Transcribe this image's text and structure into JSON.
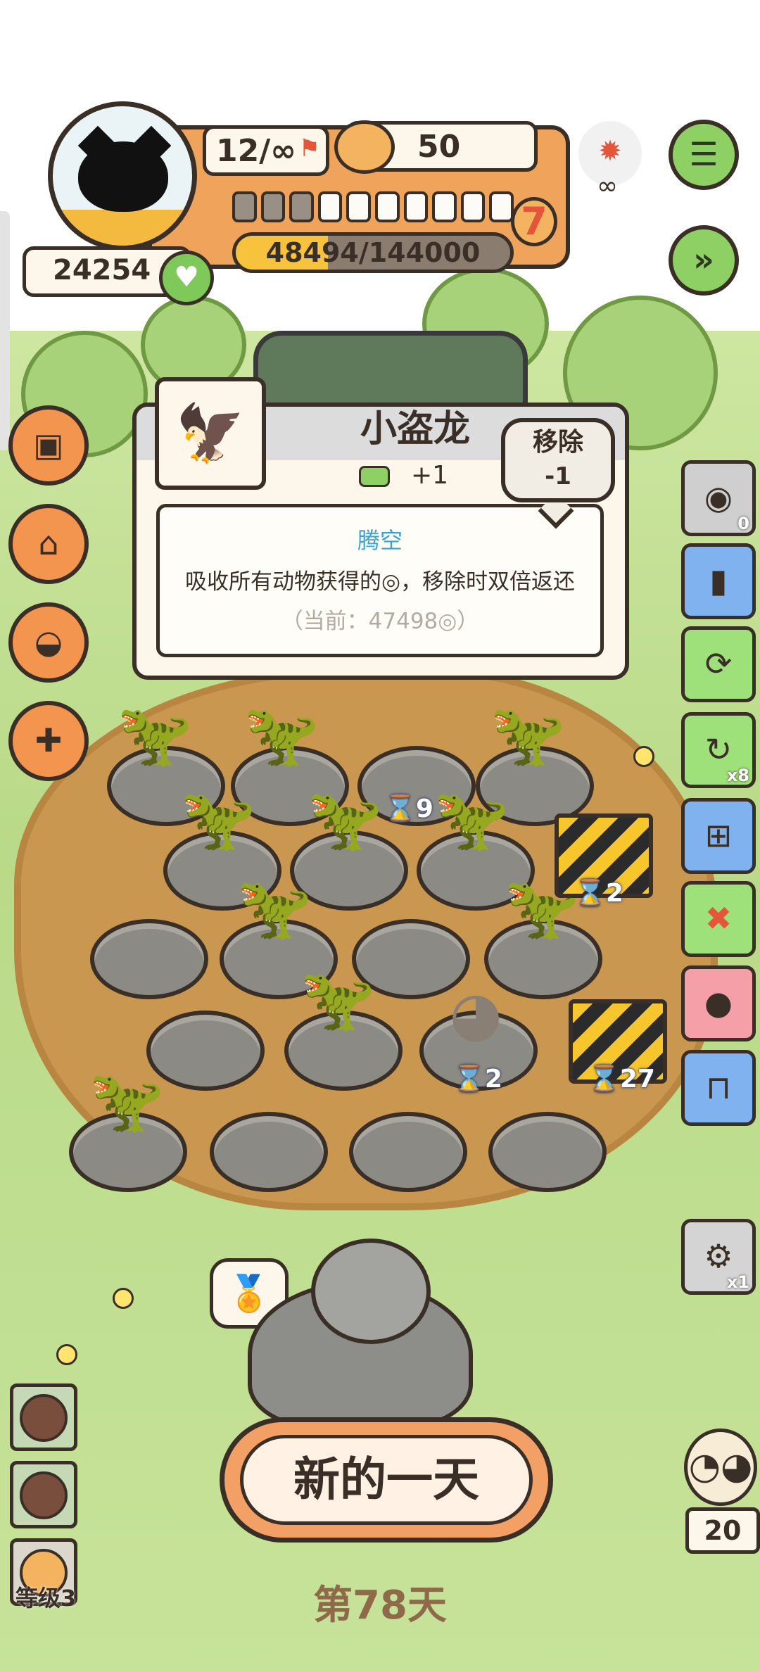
{
  "hud": {
    "moves": "12/∞",
    "coins": "50",
    "score": "24254",
    "level": "7",
    "xp_text": "48494/144000",
    "xp_fraction": 0.3368,
    "segments_total": 10,
    "segments_filled": 3,
    "infinity": "∞"
  },
  "popup": {
    "animal_name": "小盗龙",
    "bonus": "+1",
    "remove_label": "移除",
    "remove_cost": "-1",
    "ability_name": "腾空",
    "ability_desc": "吸收所有动物获得的◎，移除时双倍返还",
    "ability_current": "（当前：47498◎）"
  },
  "grid": {
    "timers": [
      "9",
      "2",
      "2",
      "27"
    ]
  },
  "side_panel": {
    "counts": [
      "0",
      "x8",
      "x1"
    ]
  },
  "bottom": {
    "new_day_label": "新的一天",
    "day_label": "第78天",
    "level_label": "等级3",
    "owl_count": "20"
  },
  "colors": {
    "accent_orange": "#f0a35b",
    "dirt": "#c9974f",
    "grass": "#b9da88",
    "ability_blue": "#3ba3d3",
    "xp_fill": "#f7c23c",
    "danger_red": "#e4553a"
  },
  "icons": [
    "menu-icon",
    "fast-forward-icon",
    "flame-icon",
    "heart-icon",
    "box-icon",
    "tower-icon",
    "bowl-icon",
    "gameboy-icon",
    "certificate-icon",
    "owl-icon"
  ]
}
